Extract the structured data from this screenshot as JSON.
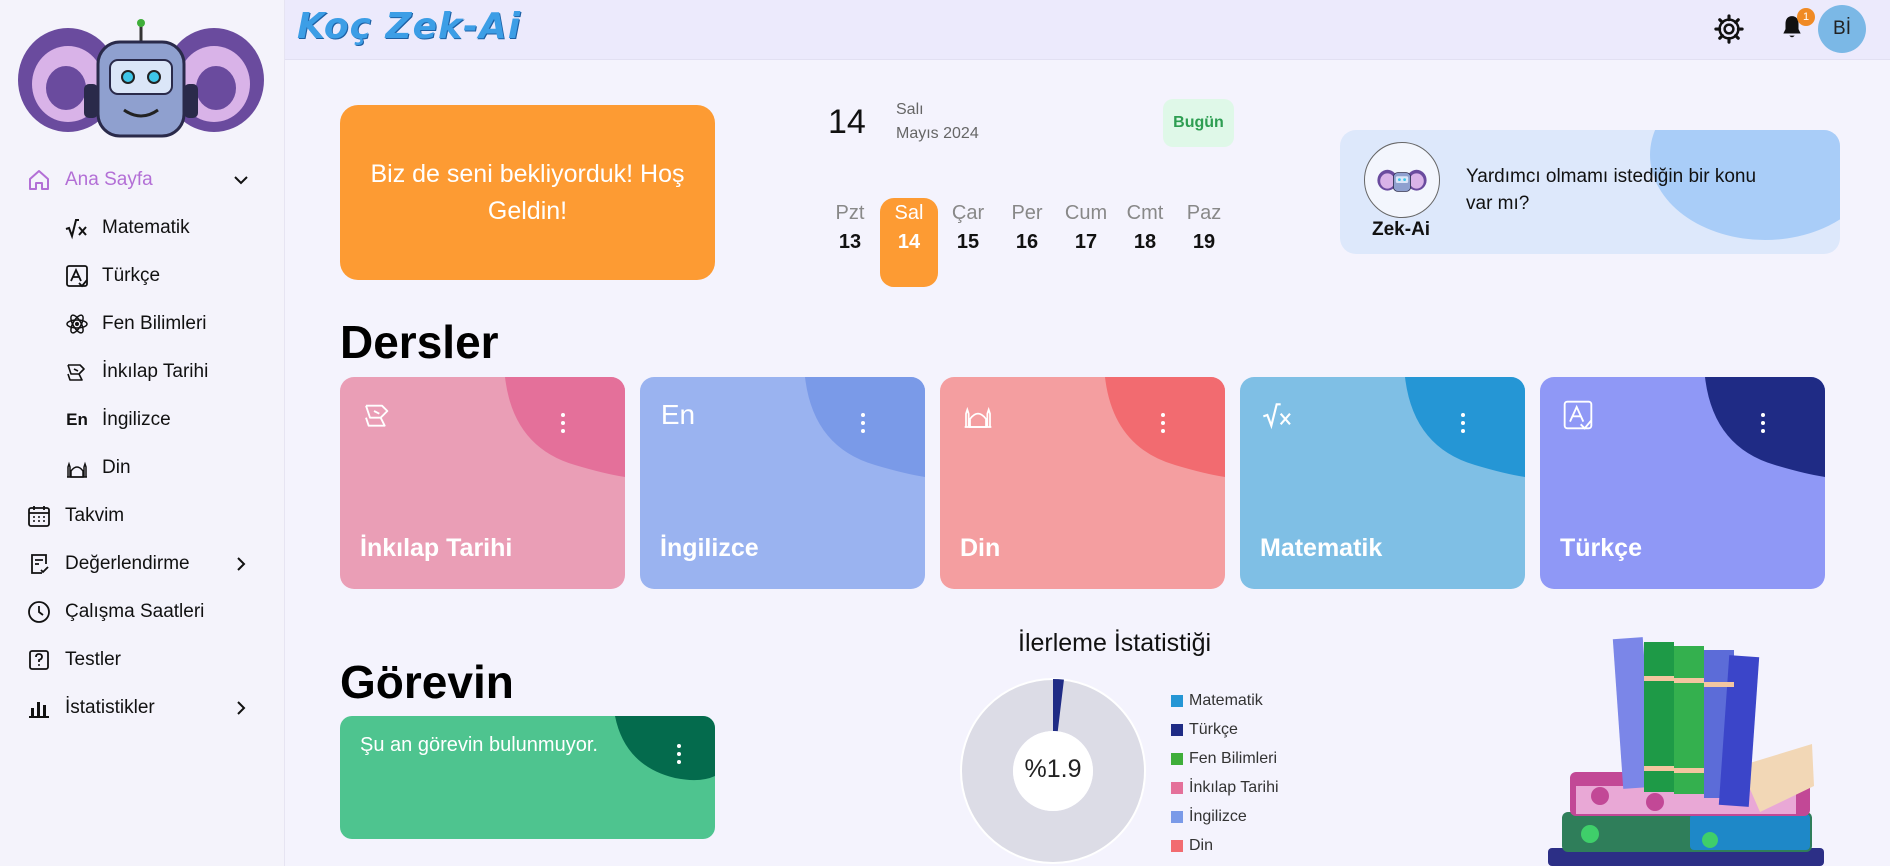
{
  "app": {
    "brand": "Koç Zek-Ai"
  },
  "sidebar": {
    "items": [
      {
        "label": "Ana Sayfa",
        "icon": "home-icon",
        "active": true
      },
      {
        "label": "Matematik",
        "icon": "math-icon"
      },
      {
        "label": "Türkçe",
        "icon": "turkish-icon"
      },
      {
        "label": "Fen Bilimleri",
        "icon": "atom-icon"
      },
      {
        "label": "İnkılap Tarihi",
        "icon": "history-icon"
      },
      {
        "label": "İngilizce",
        "icon": "english-icon",
        "glyph": "En"
      },
      {
        "label": "Din",
        "icon": "mosque-icon"
      },
      {
        "label": "Takvim",
        "icon": "calendar-icon"
      },
      {
        "label": "Değerlendirme",
        "icon": "evaluation-icon"
      },
      {
        "label": "Çalışma Saatleri",
        "icon": "clock-icon"
      },
      {
        "label": "Testler",
        "icon": "test-icon"
      },
      {
        "label": "İstatistikler",
        "icon": "stats-icon"
      }
    ]
  },
  "header": {
    "notification_count": "1",
    "avatar_initials": "Bİ"
  },
  "welcome": {
    "text": "Biz de seni bekliyorduk! Hoş Geldin!"
  },
  "calendar": {
    "day_number": "14",
    "weekday": "Salı",
    "month_year": "Mayıs 2024",
    "today_label": "Bugün",
    "week": [
      {
        "name": "Pzt",
        "date": "13"
      },
      {
        "name": "Sal",
        "date": "14",
        "selected": true
      },
      {
        "name": "Çar",
        "date": "15"
      },
      {
        "name": "Per",
        "date": "16"
      },
      {
        "name": "Cum",
        "date": "17"
      },
      {
        "name": "Cmt",
        "date": "18"
      },
      {
        "name": "Paz",
        "date": "19"
      }
    ]
  },
  "assistant": {
    "name": "Zek-Ai",
    "message": "Yardımcı olmamı istediğin bir konu var mı?"
  },
  "lessons": {
    "title": "Dersler",
    "cards": [
      {
        "title": "İnkılap Tarihi",
        "icon": "history-icon",
        "bg": "#ea9eb6",
        "accent": "#e4709a"
      },
      {
        "title": "İngilizce",
        "icon": "english-icon",
        "glyph": "En",
        "bg": "#9ab3f0",
        "accent": "#7a9ae8"
      },
      {
        "title": "Din",
        "icon": "mosque-icon",
        "bg": "#f49ea0",
        "accent": "#f26b70"
      },
      {
        "title": "Matematik",
        "icon": "math-icon",
        "bg": "#7fbfe5",
        "accent": "#2596d5"
      },
      {
        "title": "Türkçe",
        "icon": "turkish-icon",
        "bg": "#8f98f6",
        "accent": "#1f2b85"
      }
    ]
  },
  "tasks": {
    "title": "Görevin",
    "empty_text": "Şu an görevin bulunmuyor.",
    "bg": "#4ec48f",
    "accent": "#046b4d"
  },
  "progress": {
    "title": "İlerleme İstatistiği",
    "center_label": "%1.9",
    "percent": 1.9,
    "legend": [
      {
        "label": "Matematik",
        "color": "#2596d5"
      },
      {
        "label": "Türkçe",
        "color": "#1f2b85"
      },
      {
        "label": "Fen Bilimleri",
        "color": "#3fae3a"
      },
      {
        "label": "İnkılap Tarihi",
        "color": "#e4709a"
      },
      {
        "label": "İngilizce",
        "color": "#7a9ae8"
      },
      {
        "label": "Din",
        "color": "#f26b70"
      }
    ]
  }
}
